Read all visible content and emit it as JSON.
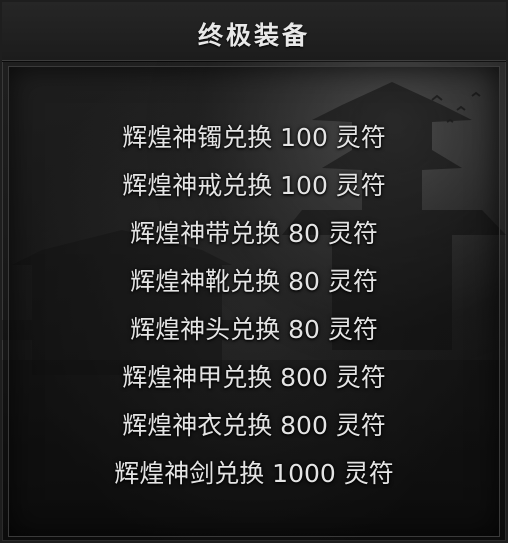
{
  "window": {
    "title": "终极装备"
  },
  "exchange_list": [
    {
      "text": "辉煌神镯兑换 100 灵符"
    },
    {
      "text": "辉煌神戒兑换 100 灵符"
    },
    {
      "text": "辉煌神带兑换 80 灵符"
    },
    {
      "text": "辉煌神靴兑换 80 灵符"
    },
    {
      "text": "辉煌神头兑换 80 灵符"
    },
    {
      "text": "辉煌神甲兑换 800 灵符"
    },
    {
      "text": "辉煌神衣兑换 800 灵符"
    },
    {
      "text": "辉煌神剑兑换 1000 灵符"
    }
  ],
  "background": {
    "scene": "pagoda-silhouette-night"
  }
}
